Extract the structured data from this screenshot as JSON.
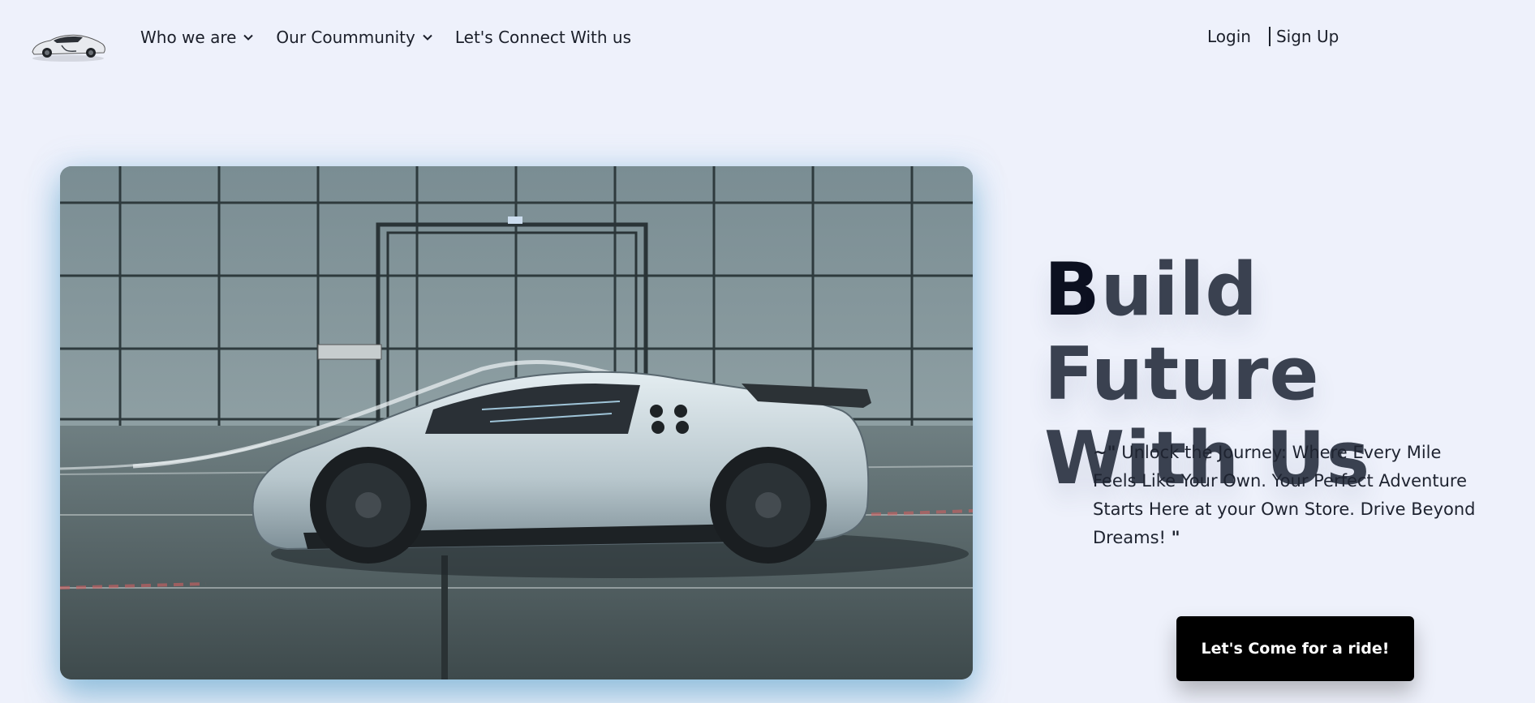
{
  "nav": {
    "logo_icon": "sports-car-logo",
    "items": [
      {
        "label": "Who we are",
        "has_dropdown": true
      },
      {
        "label": "Our Coummunity",
        "has_dropdown": true
      },
      {
        "label": "Let's Connect With us",
        "has_dropdown": false
      }
    ],
    "login_label": "Login",
    "signup_label": "Sign Up"
  },
  "hero": {
    "image_icon": "supercar-wind-tunnel-photo",
    "headline_first_letter": "B",
    "headline_rest_line1": "uild Future",
    "headline_line2": "With Us",
    "quote_open": "~\"",
    "quote_text": " Unlock the Journey: Where Every Mile Feels Like Your Own. Your Perfect Adventure Starts Here at your Own Store. Drive Beyond Dreams! ",
    "quote_close": "\"",
    "cta_label": "Let's Come for a ride!"
  },
  "colors": {
    "background": "#eef1fb",
    "headline": "#3a4150",
    "cta_bg": "#000000",
    "image_glow": "#5aa0c8"
  }
}
